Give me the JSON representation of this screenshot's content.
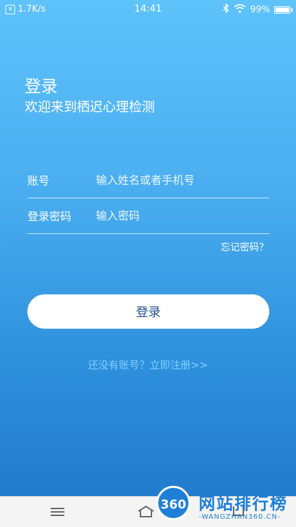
{
  "status_bar": {
    "speed": "1.7K/s",
    "time": "14:41",
    "battery": "99%",
    "battery_level": 0.99
  },
  "login": {
    "title": "登录",
    "subtitle": "欢迎来到栖迟心理检测",
    "account_label": "账号",
    "account_placeholder": "输入姓名或者手机号",
    "account_value": "",
    "password_label": "登录密码",
    "password_placeholder": "输入密码",
    "password_value": "",
    "forgot_password": "忘记密码？",
    "login_button": "登录",
    "register_link": "还没有账号？立即注册>>"
  },
  "watermark": {
    "logo": "360",
    "text": "网站排行榜",
    "url": "-WANGZHAN360.CN-"
  },
  "colors": {
    "background_top": "#5ec2fb",
    "background_bottom": "#1f76c9",
    "button_text": "#1f4e8f",
    "register_link": "#7fd0ff"
  }
}
